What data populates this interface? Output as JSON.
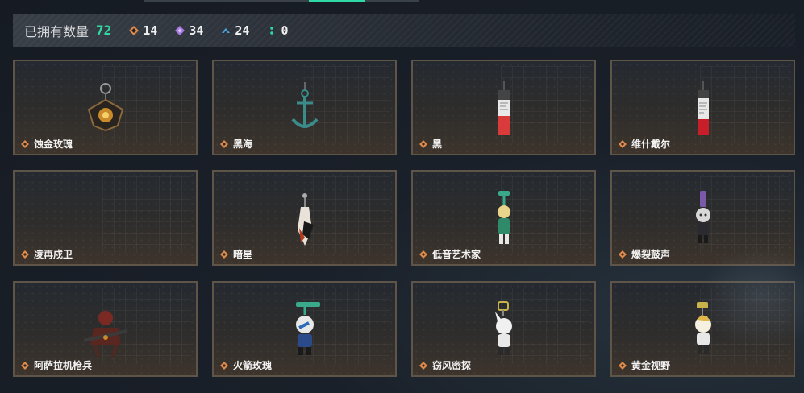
{
  "header": {
    "owned_label": "已拥有数量",
    "owned_count": "72",
    "stats": [
      {
        "icon": "orange-diamond-icon",
        "color": "#e08a4a",
        "value": "14"
      },
      {
        "icon": "purple-diamond-icon",
        "color": "#a77be0",
        "value": "34"
      },
      {
        "icon": "blue-chevron-icon",
        "color": "#4aa6e0",
        "value": "24"
      },
      {
        "icon": "green-dots-icon",
        "color": "#2fd9a6",
        "value": "0"
      }
    ]
  },
  "colors": {
    "accent": "#2fd9a6",
    "card_border": "#5e5448",
    "rarity_orange": "#e08a4a"
  },
  "cards": [
    {
      "name": "蚀金玫瑰",
      "rarity": "orange"
    },
    {
      "name": "黑海",
      "rarity": "orange"
    },
    {
      "name": "黑",
      "rarity": "orange"
    },
    {
      "name": "维什戴尔",
      "rarity": "orange"
    },
    {
      "name": "凌再戍卫",
      "rarity": "orange"
    },
    {
      "name": "暗星",
      "rarity": "orange"
    },
    {
      "name": "低音艺术家",
      "rarity": "orange"
    },
    {
      "name": "爆裂鼓声",
      "rarity": "orange"
    },
    {
      "name": "阿萨拉机枪兵",
      "rarity": "orange"
    },
    {
      "name": "火箭玫瑰",
      "rarity": "orange"
    },
    {
      "name": "窃风密探",
      "rarity": "orange"
    },
    {
      "name": "黄金视野",
      "rarity": "orange"
    }
  ]
}
